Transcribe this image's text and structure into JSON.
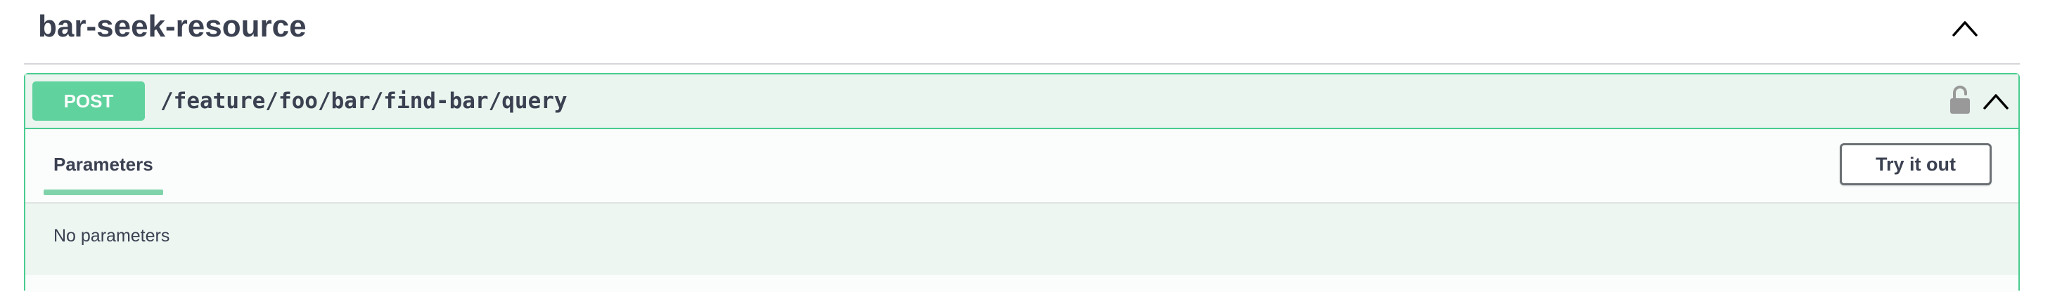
{
  "tag": {
    "title": "bar-seek-resource",
    "collapse_icon": "chevron-up-icon"
  },
  "operation": {
    "method": "POST",
    "path": "/feature/foo/bar/find-bar/query",
    "lock_icon": "unlocked-padlock-icon",
    "collapse_icon": "chevron-up-icon",
    "tabs": [
      {
        "label": "Parameters",
        "active": true
      }
    ],
    "try_button_label": "Try it out",
    "parameters_message": "No parameters"
  },
  "colors": {
    "post_accent": "#49cc90",
    "post_background": "#eef6f2",
    "text": "#3b4151",
    "lock_icon": "#999999"
  }
}
